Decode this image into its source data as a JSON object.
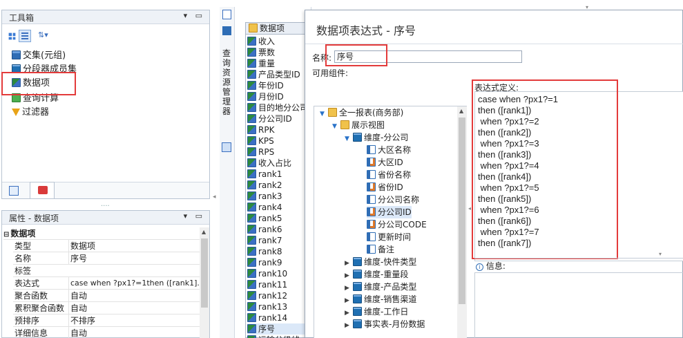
{
  "toolbox": {
    "title": "工具箱",
    "controls": "▾ ▭",
    "items": [
      {
        "label": "交集(元组)",
        "icon": "intersection-icon"
      },
      {
        "label": "分段器成员集",
        "icon": "segment-members-icon"
      },
      {
        "label": "数据项",
        "icon": "data-item-icon"
      },
      {
        "label": "查询计算",
        "icon": "query-calc-icon"
      },
      {
        "label": "过滤器",
        "icon": "filter-icon"
      }
    ]
  },
  "properties": {
    "title": "属性 - 数据项",
    "section": "数据项",
    "rows": [
      {
        "key": "类型",
        "value": "数据项"
      },
      {
        "key": "名称",
        "value": "序号"
      },
      {
        "key": "标签",
        "value": ""
      },
      {
        "key": "表达式",
        "value": "case when ?px1?=1then ([rank1]..."
      },
      {
        "key": "聚合函数",
        "value": "自动"
      },
      {
        "key": "累积聚合函数",
        "value": "自动"
      },
      {
        "key": "预排序",
        "value": "不排序"
      },
      {
        "key": "详细信息",
        "value": "自动"
      }
    ]
  },
  "side_tab": {
    "label": "查询资源管理器"
  },
  "query_fields": {
    "header": "数据项",
    "items": [
      "收入",
      "票数",
      "重量",
      "产品类型ID",
      "年份ID",
      "月份ID",
      "目的地分公司",
      "分公司ID",
      "RPK",
      "KPS",
      "RPS",
      "收入占比",
      "rank1",
      "rank2",
      "rank3",
      "rank4",
      "rank5",
      "rank6",
      "rank7",
      "rank8",
      "rank9",
      "rank10",
      "rank11",
      "rank12",
      "rank13",
      "rank14",
      "序号",
      "运输分级线"
    ]
  },
  "dialog": {
    "title": "数据项表达式 - 序号",
    "name_label": "名称:",
    "name_value": "序号",
    "components_label": "可用组件:",
    "expr_label": "表达式定义:",
    "info_label": "信息:",
    "expression_lines": [
      "case when ?px1?=1",
      "then ([rank1])",
      " when ?px1?=2",
      "then ([rank2])",
      " when ?px1?=3",
      "then ([rank3])",
      " when ?px1?=4",
      "then ([rank4])",
      " when ?px1?=5",
      "then ([rank5])",
      " when ?px1?=6",
      "then ([rank6])",
      " when ?px1?=7",
      "then ([rank7])"
    ],
    "tree": {
      "root": "全一报表(商务部)",
      "view": "展示视图",
      "dim_company": "维度-分公司",
      "company_fields": [
        "大区名称",
        "大区ID",
        "省份名称",
        "省份ID",
        "分公司名称",
        "分公司ID",
        "分公司CODE",
        "更新时间",
        "备注"
      ],
      "others": [
        "维度-快件类型",
        "维度-重量段",
        "维度-产品类型",
        "维度-销售渠道",
        "维度-工作日",
        "事实表-月份数据"
      ]
    }
  }
}
